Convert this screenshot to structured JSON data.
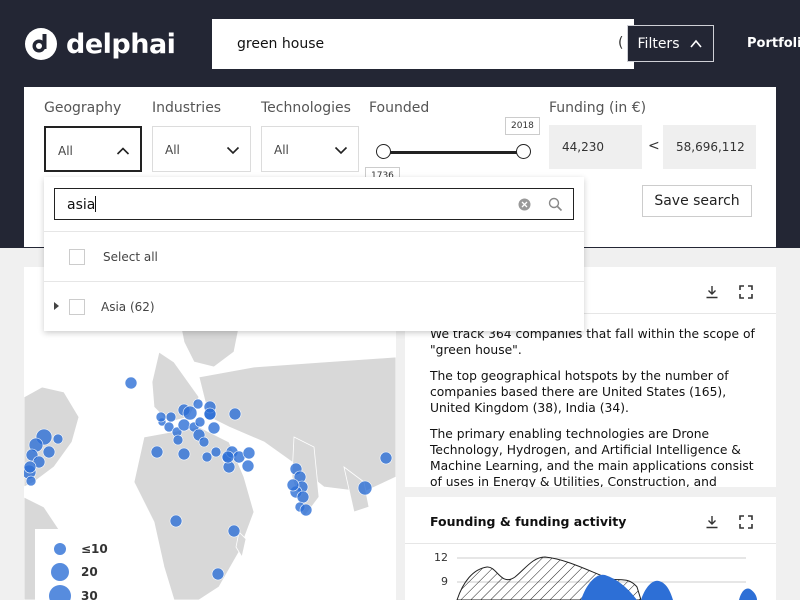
{
  "header": {
    "logo_text": "delphai",
    "search_value": "green house",
    "search_trailing": "(",
    "filters_label": "Filters",
    "nav_portfolio": "Portfolio"
  },
  "filters": {
    "geography": {
      "label": "Geography",
      "value": "All"
    },
    "industries": {
      "label": "Industries",
      "value": "All"
    },
    "technologies": {
      "label": "Technologies",
      "value": "All"
    },
    "founded": {
      "label": "Founded",
      "min_tip": "1736",
      "max_tip": "2018"
    },
    "funding": {
      "label": "Funding (in €)",
      "min": "44,230",
      "separator": "<",
      "max": "58,696,112"
    },
    "save_label": "Save search"
  },
  "dropdown": {
    "query": "asia",
    "select_all": "Select all",
    "option": "Asia (62)"
  },
  "map": {
    "legend": [
      "≤10",
      "20",
      "30"
    ]
  },
  "description": {
    "p1": "We track 364 companies that fall within the scope of \"green house\".",
    "p2": "The top geographical hotspots by the number of companies based there are United States (165), United Kingdom (38), India (34).",
    "p3": "The primary enabling technologies are Drone Technology, Hydrogen, and Artificial Intelligence & Machine Learning, and the main applications consist of uses in Energy & Utilities, Construction, and"
  },
  "founding": {
    "title": "Founding & funding activity",
    "y_ticks": [
      "12",
      "9"
    ]
  },
  "colors": {
    "dark": "#232634",
    "accent": "#2d6fd6",
    "land": "#d8d8d8"
  }
}
